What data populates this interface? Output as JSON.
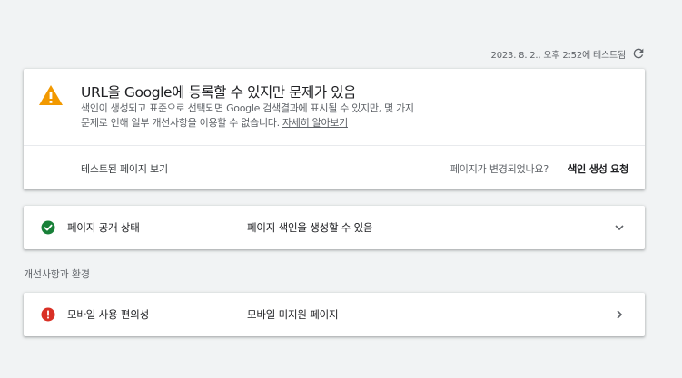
{
  "test_time": {
    "text": "2023. 8. 2., 오후 2:52에 테스트됨",
    "icon": "refresh-icon"
  },
  "status_card": {
    "icon": "warning-icon",
    "icon_color": "#f29900",
    "title": "URL을 Google에 등록할 수 있지만 문제가 있음",
    "description_line1": "색인이 생성되고 표준으로 선택되면 Google 검색결과에 표시될 수 있지만, 몇 가지",
    "description_line2": "문제로 인해 일부 개선사항을 이용할 수 없습니다.",
    "learn_more": "자세히 알아보기",
    "view_tested_page": "테스트된 페이지 보기",
    "page_changed": "페이지가 변경되었나요?",
    "request_indexing": "색인 생성 요청"
  },
  "page_availability": {
    "icon": "check-circle-icon",
    "icon_color": "#188038",
    "label": "페이지 공개 상태",
    "value": "페이지 색인을 생성할 수 있음",
    "chevron": "chevron-down-icon"
  },
  "enhancements": {
    "heading": "개선사항과 환경",
    "items": [
      {
        "icon": "error-icon",
        "icon_color": "#d93025",
        "label": "모바일 사용 편의성",
        "value": "모바일 미지원 페이지",
        "chevron": "chevron-right-icon"
      }
    ]
  }
}
